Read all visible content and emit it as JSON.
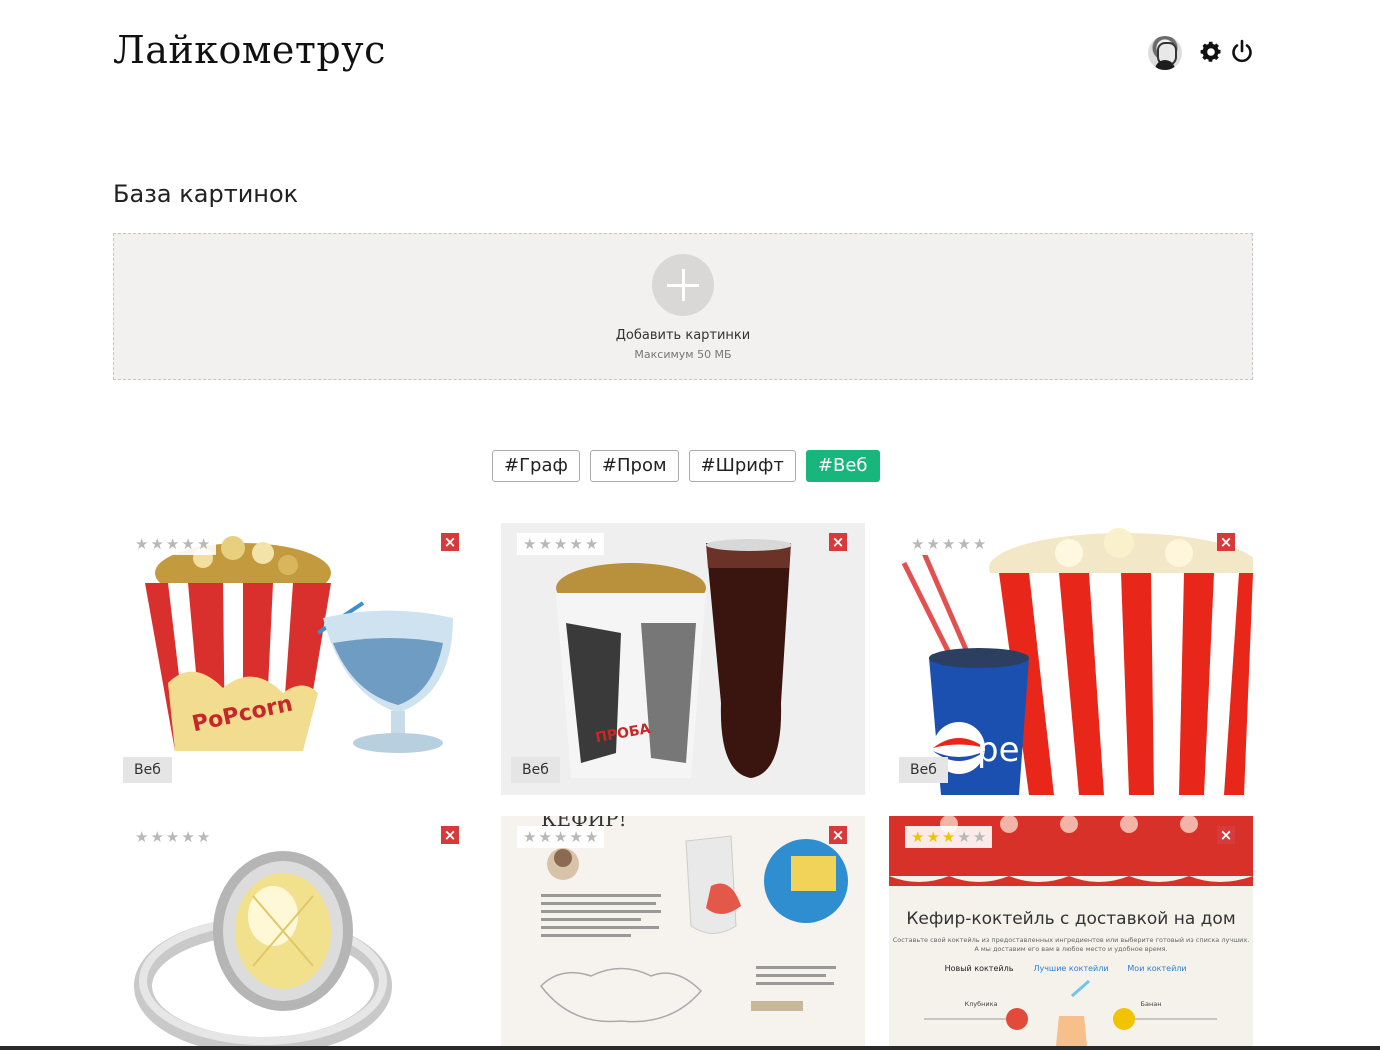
{
  "app": {
    "title": "Лайкометрус"
  },
  "header": {
    "avatar_icon": "user-avatar",
    "settings_icon": "gear-icon",
    "logout_icon": "power-icon"
  },
  "section": {
    "title": "База картинок"
  },
  "uploader": {
    "label": "Добавить картинки",
    "limit": "Максимум 50 МБ"
  },
  "filters": {
    "tags": [
      "#Граф",
      "#Пром",
      "#Шрифт",
      "#Веб"
    ],
    "active": "#Веб",
    "accent_color": "#16b67c"
  },
  "gallery": {
    "cards": [
      {
        "tag": "Веб",
        "rating": 0,
        "subject": "popcorn bucket and glass of water"
      },
      {
        "tag": "Веб",
        "rating": 0,
        "subject": "popcorn cup and cola glass"
      },
      {
        "tag": "Веб",
        "rating": 0,
        "subject": "striped popcorn bucket and pepsi cup"
      },
      {
        "tag": "",
        "rating": 0,
        "subject": "diamond ring"
      },
      {
        "tag": "",
        "rating": 0,
        "subject": "kefir web page"
      },
      {
        "tag": "",
        "rating": 3,
        "subject": "kefir cocktail delivery web page"
      }
    ],
    "max_rating": 5,
    "web_texts": {
      "kefir_heading": "КЕФИР!",
      "cocktail_title": "Кефир-коктейль с доставкой на дом",
      "cocktail_sub": "Составьте свой коктейль из предоставленных ингредиентов или выберите готовый из списка лучших.",
      "cocktail_sub2": "А мы доставим его вам в любое место и удобное время.",
      "tab1": "Новый коктейль",
      "tab2": "Лучшие коктейли",
      "tab3": "Мои коктейли",
      "ing1": "Клубника",
      "ing2": "Банан"
    }
  }
}
